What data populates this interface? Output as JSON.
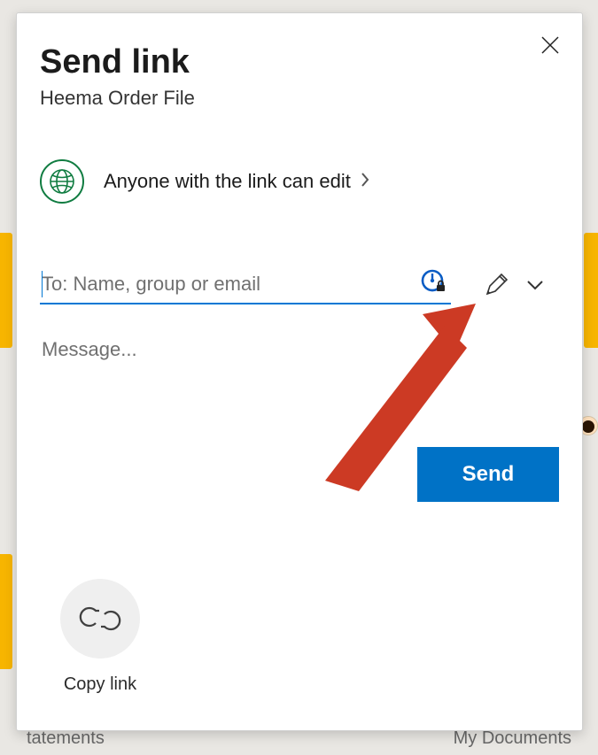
{
  "dialog": {
    "title": "Send link",
    "filename": "Heema Order File",
    "scope_text": "Anyone with the link can edit",
    "to_placeholder": "To: Name, group or email",
    "to_value": "",
    "message_placeholder": "Message...",
    "message_value": "",
    "send_label": "Send",
    "copy_label": "Copy link"
  },
  "background": {
    "bottom_left": "tatements",
    "bottom_right": "My Documents"
  }
}
